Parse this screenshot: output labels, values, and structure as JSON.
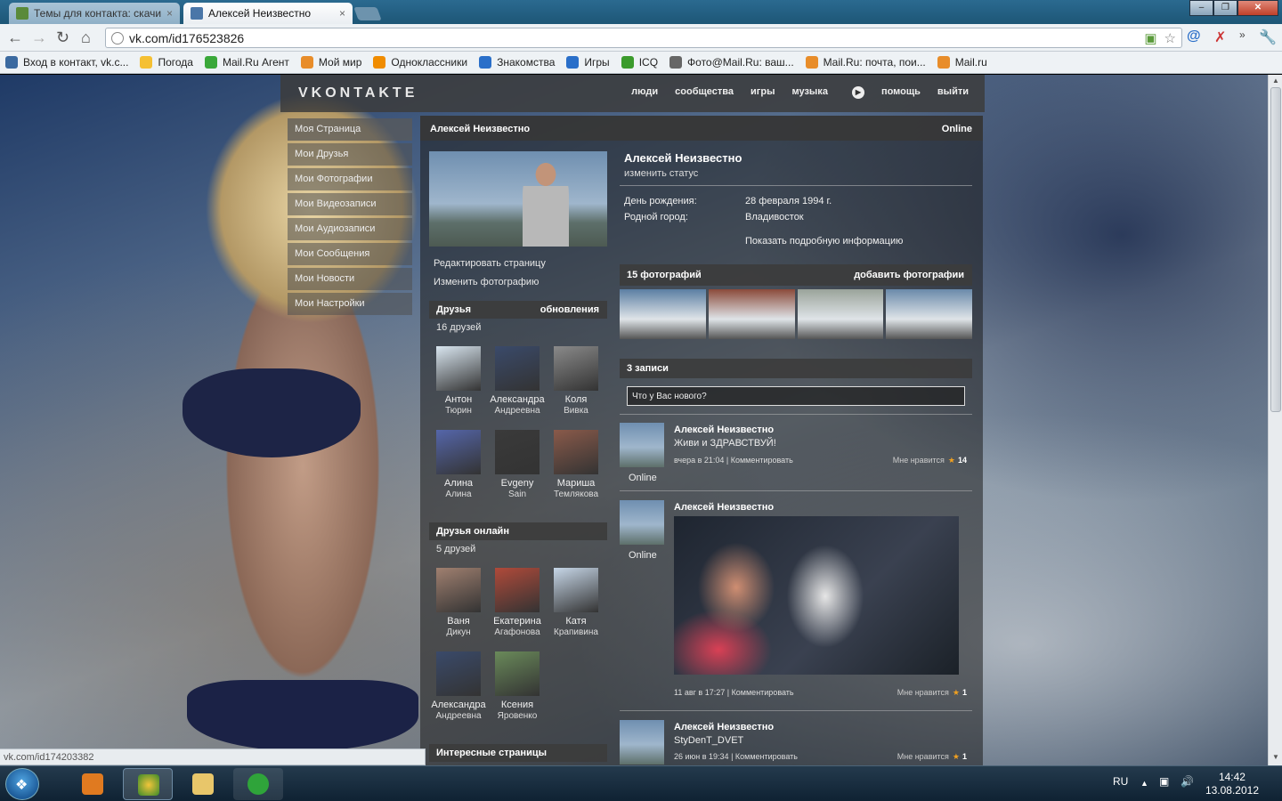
{
  "browser": {
    "tabs": [
      {
        "title": "Темы для контакта: скачи",
        "active": false
      },
      {
        "title": "Алексей Неизвестно",
        "active": true
      }
    ],
    "url": "vk.com/id176523826",
    "bookmarks": [
      {
        "label": "Вход в контакт, vk.c...",
        "icon_color": "#3b6aa0"
      },
      {
        "label": "Погода",
        "icon_color": "#f5c033"
      },
      {
        "label": "Mail.Ru Агент",
        "icon_color": "#3aa83a"
      },
      {
        "label": "Мой мир",
        "icon_color": "#e88d2a"
      },
      {
        "label": "Одноклассники",
        "icon_color": "#f08c00"
      },
      {
        "label": "Знакомства",
        "icon_color": "#2a6fc9"
      },
      {
        "label": "Игры",
        "icon_color": "#2a6fc9"
      },
      {
        "label": "ICQ",
        "icon_color": "#3b9b2c"
      },
      {
        "label": "Фото@Mail.Ru: ваш...",
        "icon_color": "#666"
      },
      {
        "label": "Mail.Ru: почта, пои...",
        "icon_color": "#e88d2a"
      },
      {
        "label": "Mail.ru",
        "icon_color": "#e88d2a"
      }
    ],
    "status_url": "vk.com/id174203382"
  },
  "vk": {
    "logo": "VKONTAKTE",
    "nav": [
      "люди",
      "сообщества",
      "игры",
      "музыка",
      "помощь",
      "выйти"
    ],
    "menu": [
      "Моя Страница",
      "Мои Друзья",
      "Мои Фотографии",
      "Мои Видеозаписи",
      "Мои Аудиозаписи",
      "Мои Сообщения",
      "Мои Новости",
      "Мои Настройки"
    ]
  },
  "profile": {
    "header_name": "Алексей Неизвестно",
    "header_status": "Online",
    "name": "Алексей Неизвестно",
    "change_status": "изменить статус",
    "edit_page": "Редактировать страницу",
    "change_photo": "Изменить фотографию",
    "info": [
      {
        "label": "День рождения:",
        "value": "28 февраля 1994 г."
      },
      {
        "label": "Родной город:",
        "value": "Владивосток"
      }
    ],
    "show_more": "Показать подробную информацию",
    "photos_title": "15 фотографий",
    "add_photos": "добавить фотографии",
    "photo_colors": [
      "#5b7fa3",
      "#8b4a3a",
      "#9aa39a",
      "#6a8aaa"
    ]
  },
  "friends": {
    "title": "Друзья",
    "updates": "обновления",
    "count": "16 друзей",
    "list": [
      {
        "first": "Антон",
        "last": "Тюрин",
        "color": "#d9e6f0"
      },
      {
        "first": "Александра",
        "last": "Андреевна",
        "color": "#3a4a6a"
      },
      {
        "first": "Коля",
        "last": "Вивка",
        "color": "#8a8a8a"
      },
      {
        "first": "Алина",
        "last": "Алина",
        "color": "#5566aa"
      },
      {
        "first": "Evgeny",
        "last": "Sain",
        "color": "#3a3a3a"
      },
      {
        "first": "Мариша",
        "last": "Темлякова",
        "color": "#8a5a4a"
      }
    ]
  },
  "friends_online": {
    "title": "Друзья онлайн",
    "count": "5 друзей",
    "list": [
      {
        "first": "Ваня",
        "last": "Дикун",
        "color": "#a08070"
      },
      {
        "first": "Екатерина",
        "last": "Агафонова",
        "color": "#b04a3a"
      },
      {
        "first": "Катя",
        "last": "Крапивина",
        "color": "#c7d7e8"
      },
      {
        "first": "Александра",
        "last": "Андреевна",
        "color": "#3a4a6a"
      },
      {
        "first": "Ксения",
        "last": "Яровенко",
        "color": "#6a8a5a"
      }
    ]
  },
  "interesting_pages": "Интересные страницы",
  "wall": {
    "title": "3 записи",
    "placeholder": "Что у Вас нового?",
    "posts": [
      {
        "author": "Алексей Неизвестно",
        "text": "Живи и ЗДРАВСТВУЙ!",
        "date": "вчера в 21:04",
        "comment": "Комментировать",
        "like_label": "Мне нравится",
        "likes": "14",
        "online": "Online"
      },
      {
        "author": "Алексей Неизвестно",
        "text": "",
        "date": "11 авг в 17:27",
        "comment": "Комментировать",
        "like_label": "Мне нравится",
        "likes": "1",
        "online": "Online"
      },
      {
        "author": "Алексей Неизвестно",
        "text": "StyDenT_DVET",
        "date": "26 июн в 19:34",
        "comment": "Комментировать",
        "like_label": "Мне нравится",
        "likes": "1",
        "online": ""
      }
    ]
  },
  "taskbar": {
    "lang": "RU",
    "time": "14:42",
    "date": "13.08.2012"
  }
}
